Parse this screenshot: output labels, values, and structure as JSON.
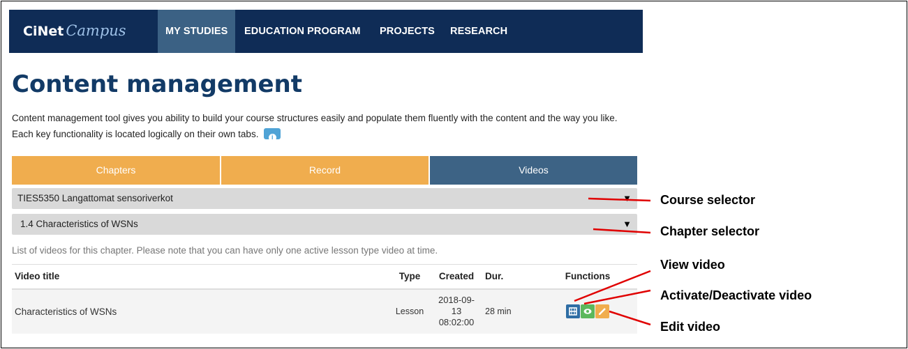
{
  "nav": {
    "logo_bold": "CiNet",
    "logo_script": "Campus",
    "items": [
      "MY STUDIES",
      "EDUCATION PROGRAM",
      "PROJECTS",
      "RESEARCH"
    ]
  },
  "page": {
    "title": "Content management",
    "description": "Content management tool gives you ability to build your course structures easily and populate them fluently with the content and the way you like. Each key functionality is located logically on their own tabs."
  },
  "tabs": [
    "Chapters",
    "Record",
    "Videos"
  ],
  "selectors": {
    "course": "TIES5350 Langattomat sensoriverkot",
    "chapter": "1.4 Characteristics of WSNs"
  },
  "note": "List of videos for this chapter. Please note that you can have only one active lesson type video at time.",
  "table": {
    "headers": [
      "Video title",
      "Type",
      "Created",
      "Dur.",
      "Functions"
    ],
    "rows": [
      {
        "title": "Characteristics of WSNs",
        "type": "Lesson",
        "created_1": "2018-09-",
        "created_2": "13",
        "created_3": "08:02:00",
        "duration": "28 min"
      }
    ]
  },
  "annotations": {
    "course_selector": "Course selector",
    "chapter_selector": "Chapter selector",
    "view_video": "View video",
    "activate_video": "Activate/Deactivate video",
    "edit_video": "Edit video"
  },
  "colors": {
    "nav_bg": "#0f2c56",
    "tab_orange": "#f0ad4e",
    "tab_blue": "#3d6385",
    "annotation_line": "#e00000"
  }
}
